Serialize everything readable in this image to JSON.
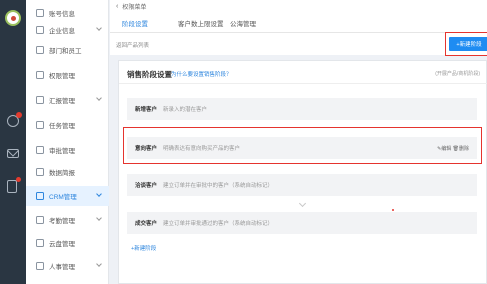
{
  "topbar": {
    "back_icon": "‹",
    "title": "权限菜单"
  },
  "sidebar": {
    "items": [
      {
        "label": "账号信息",
        "icon": "user-icon"
      },
      {
        "label": "企业信息",
        "icon": "building-icon"
      },
      {
        "label": "部门和员工",
        "icon": "org-icon"
      },
      {
        "label": "权限管理",
        "icon": "lock-icon"
      },
      {
        "label": "汇报管理",
        "icon": "report-icon"
      },
      {
        "label": "任务管理",
        "icon": "task-icon"
      },
      {
        "label": "审批管理",
        "icon": "approve-icon"
      },
      {
        "label": "数据简报",
        "icon": "data-icon"
      },
      {
        "label": "CRM管理",
        "icon": "crm-icon",
        "active": true
      },
      {
        "label": "考勤管理",
        "icon": "clock-icon"
      },
      {
        "label": "云盘管理",
        "icon": "cloud-icon"
      },
      {
        "label": "人事管理",
        "icon": "person-icon"
      }
    ]
  },
  "tabs": [
    {
      "label": "阶段设置",
      "active": true
    },
    {
      "label": "客户数上限设置"
    },
    {
      "label": "公海管理"
    }
  ],
  "subbar": {
    "back_label": "返回产品列表",
    "new_button": "+新建阶段"
  },
  "panel": {
    "title": "销售阶段设置",
    "help": "为什么要设置销售阶段？",
    "hint": "(开展产品/商机阶段)",
    "stages": [
      {
        "name": "新增客户",
        "desc": "新录入的潜在客户"
      },
      {
        "name": "意向客户",
        "desc": "明确表达有意向购买产品的客户",
        "actions": "✎编辑  🗑删除"
      },
      {
        "name": "洽谈客户",
        "desc": "建立订单并在审批中的客户（系统自动标记）"
      },
      {
        "name": "成交客户",
        "desc": "建立订单并审批通过的客户（系统自动标记）"
      }
    ],
    "add_label": "+新建阶段"
  },
  "colors": {
    "accent": "#2e86de",
    "highlight": "#e5342e",
    "rail": "#2a3642"
  }
}
